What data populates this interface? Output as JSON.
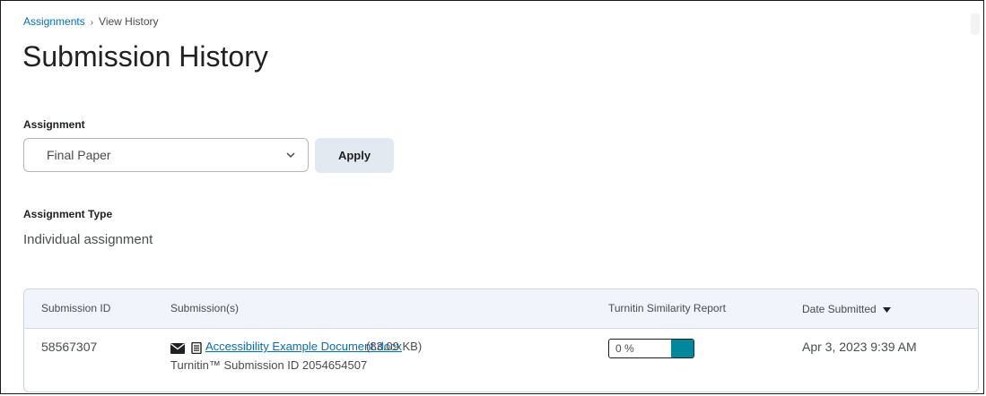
{
  "breadcrumb": {
    "parent": "Assignments",
    "separator": "›",
    "current": "View History"
  },
  "page": {
    "title": "Submission History"
  },
  "assignment": {
    "label": "Assignment",
    "selected": "Final Paper",
    "apply_label": "Apply"
  },
  "assignment_type": {
    "label": "Assignment Type",
    "value": "Individual assignment"
  },
  "table": {
    "headers": {
      "submission_id": "Submission ID",
      "submissions": "Submission(s)",
      "similarity": "Turnitin Similarity Report",
      "date": "Date Submitted"
    },
    "rows": [
      {
        "submission_id": "58567307",
        "file_name": "Accessibility Example Document.docx",
        "file_size": "(83.09 KB)",
        "turnitin_id": "Turnitin™ Submission ID 2054654507",
        "similarity_text": "0 %",
        "similarity_percent": 0,
        "date": "Apr 3, 2023 9:39 AM"
      }
    ]
  },
  "icons": {
    "mail": "envelope-icon",
    "document": "document-icon",
    "sort": "sort-down-icon",
    "chevron": "chevron-down-icon"
  },
  "colors": {
    "link": "#006fbf",
    "accent": "#00879b",
    "button_bg": "#e3e9f1",
    "header_bg": "#f1f5fb"
  }
}
